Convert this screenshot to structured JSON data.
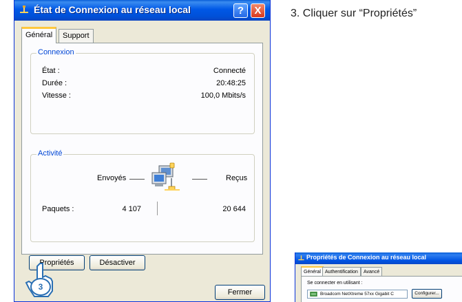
{
  "dialog": {
    "title": "État de Connexion au réseau local",
    "help_label": "?",
    "close_label": "X",
    "tabs": [
      {
        "label": "Général",
        "active": true
      },
      {
        "label": "Support",
        "active": false
      }
    ],
    "connexion": {
      "title": "Connexion",
      "rows": [
        {
          "label": "État :",
          "value": "Connecté"
        },
        {
          "label": "Durée :",
          "value": "20:48:25"
        },
        {
          "label": "Vitesse :",
          "value": "100,0 Mbits/s"
        }
      ]
    },
    "activite": {
      "title": "Activité",
      "sent_label": "Envoyés",
      "received_label": "Reçus",
      "packets_label": "Paquets :",
      "packets_sent": "4 107",
      "packets_received": "20 644"
    },
    "buttons": {
      "properties": "Propriétés",
      "disable": "Désactiver",
      "close": "Fermer"
    }
  },
  "annotation": {
    "step_text": "3. Cliquer sur “Propriétés”",
    "badge_number": "3"
  },
  "mini_dialog": {
    "title": "Propriétés de Connexion au réseau local",
    "tabs": [
      "Général",
      "Authentification",
      "Avancé"
    ],
    "connect_using_label": "Se connecter en utilisant :",
    "adapter": "Broadcom NetXtreme 57xx Gigabit C",
    "configure_label": "Configurer..."
  },
  "colors": {
    "titlebar": "#0058e6",
    "window_bg": "#ece9d8",
    "group_title": "#0046d5",
    "close_button": "#d9381e",
    "badge_fill": "#2a6fb3"
  },
  "icons": {
    "titlebar": "network-connection-icon",
    "activity": "network-computers-icon",
    "pointer": "hand-pointer-icon"
  }
}
